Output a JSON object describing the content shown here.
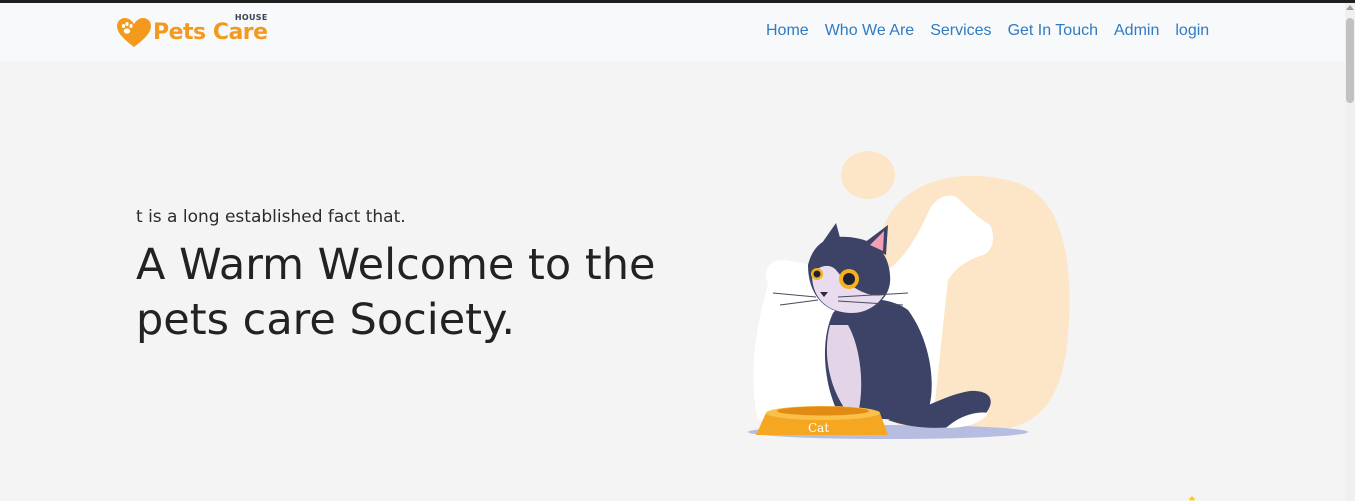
{
  "colors": {
    "brand": "#f39a1e",
    "nav_link": "#2f7bc4",
    "background": "#f4f4f4",
    "navbar_bg": "#f8f9fa"
  },
  "logo": {
    "icon": "heart-paw-icon",
    "text": "Pets Care",
    "subtext": "HOUSE"
  },
  "nav": {
    "items": [
      {
        "label": "Home"
      },
      {
        "label": "Who We Are"
      },
      {
        "label": "Services"
      },
      {
        "label": "Get In Touch"
      },
      {
        "label": "Admin"
      },
      {
        "label": "login"
      }
    ]
  },
  "hero": {
    "subtitle": "t is a long established fact that.",
    "title": "A Warm Welcome to the pets care Society.",
    "illustration": "cat-dog-illustration",
    "bowl_label": "Cat"
  }
}
